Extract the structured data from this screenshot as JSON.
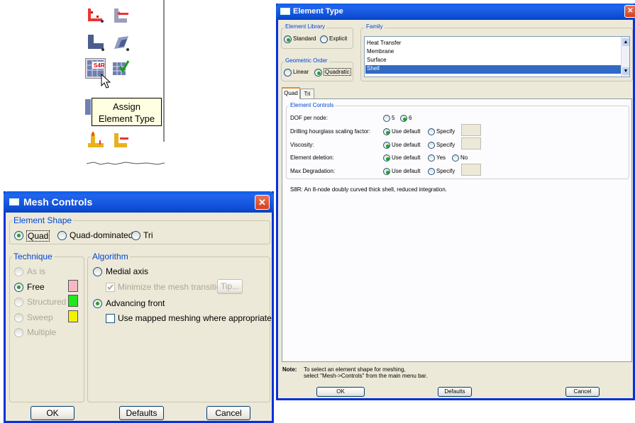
{
  "toolbox": {
    "tooltip_line1": "Assign",
    "tooltip_line2": "Element Type",
    "icon_label": "S4R"
  },
  "mesh_controls": {
    "title": "Mesh Controls",
    "close": "✕",
    "element_shape": {
      "label": "Element Shape",
      "options": [
        "Quad",
        "Quad-dominated",
        "Tri"
      ],
      "selected": "Quad"
    },
    "technique": {
      "label": "Technique",
      "options": [
        "As is",
        "Free",
        "Structured",
        "Sweep",
        "Multiple"
      ],
      "selected": "Free",
      "colors": {
        "Free": "#f4b9c4",
        "Structured": "#1ee81e",
        "Sweep": "#f2f200"
      }
    },
    "algorithm": {
      "label": "Algorithm",
      "medial_axis": "Medial axis",
      "minimize": "Minimize the mesh transition",
      "tip": "Tip...",
      "advancing_front": "Advancing front",
      "mapped": "Use mapped meshing where appropriate",
      "selected": "Advancing front"
    },
    "buttons": {
      "ok": "OK",
      "defaults": "Defaults",
      "cancel": "Cancel"
    }
  },
  "element_type": {
    "title": "Element Type",
    "close": "✕",
    "library": {
      "label": "Element Library",
      "options": [
        "Standard",
        "Explicit"
      ],
      "selected": "Standard"
    },
    "family": {
      "label": "Family",
      "items": [
        "Heat Transfer",
        "Membrane",
        "Surface",
        "Shell"
      ],
      "selected": "Shell"
    },
    "order": {
      "label": "Geometric Order",
      "options": [
        "Linear",
        "Quadratic"
      ],
      "selected": "Quadratic"
    },
    "tabs": [
      "Quad",
      "Tri"
    ],
    "controls": {
      "label": "Element Controls",
      "rows": [
        {
          "label": "DOF per node:",
          "opts": [
            "5",
            "6"
          ]
        },
        {
          "label": "Drilling hourglass scaling factor:",
          "opts": [
            "Use default",
            "Specify"
          ]
        },
        {
          "label": "Viscosity:",
          "opts": [
            "Use default",
            "Specify"
          ]
        },
        {
          "label": "Element deletion:",
          "opts": [
            "Use default",
            "Yes",
            "No"
          ]
        },
        {
          "label": "Max Degradation:",
          "opts": [
            "Use default",
            "Specify"
          ]
        }
      ]
    },
    "description": "S8R:  An 8-node doubly curved thick shell, reduced integration.",
    "note_label": "Note:",
    "note_line1": "To select an element shape for meshing,",
    "note_line2": "select \"Mesh->Controls\" from the main menu bar.",
    "buttons": {
      "ok": "OK",
      "defaults": "Defaults",
      "cancel": "Cancel"
    }
  }
}
